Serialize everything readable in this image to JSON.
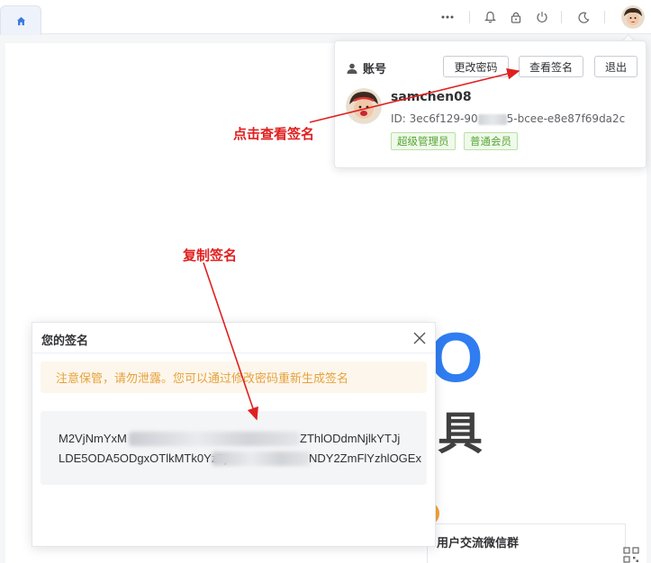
{
  "account": {
    "section_title": "账号",
    "change_password_label": "更改密码",
    "view_signature_label": "查看签名",
    "logout_label": "退出",
    "username": "samchen08",
    "id_prefix": "ID: 3ec6f129-90",
    "id_suffix": "5-bcee-e8e87f69da2c",
    "tags": [
      "超级管理员",
      "普通会员"
    ]
  },
  "annotations": {
    "click_view_signature": "点击查看签名",
    "copy_signature": "复制签名"
  },
  "signature_dialog": {
    "title": "您的签名",
    "warning": "注意保管，请勿泄露。您可以通过修改密码重新生成签名",
    "line1_start": "M2VjNmYxM",
    "line1_end": "ZThlODdmNjlkYTJj",
    "line2_start": "LDE5ODA5ODgxOTlkMTk0YzFj",
    "line2_end": "NDY2ZmFlYzhlOGEx"
  },
  "background": {
    "big_letter": "O",
    "big_char": "具",
    "wechat_group_title": "用户交流微信群"
  },
  "colors": {
    "annotation": "#e02020",
    "tag_green": "#55a532",
    "warning_orange": "#e6a23c",
    "brand_blue": "#2f7df0"
  }
}
